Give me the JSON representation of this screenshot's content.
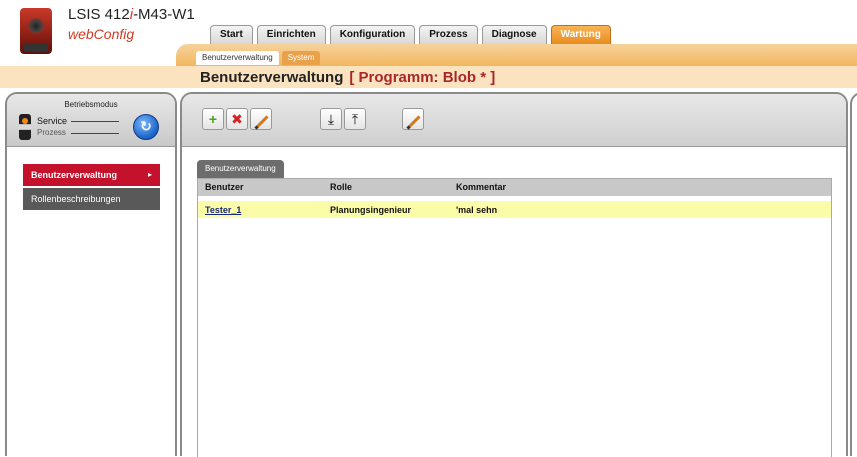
{
  "header": {
    "device_prefix": "LSIS 412",
    "device_italic": "i",
    "device_suffix": "-M43-W1",
    "app_name": "webConfig"
  },
  "main_tabs": [
    "Start",
    "Einrichten",
    "Konfiguration",
    "Prozess",
    "Diagnose",
    "Wartung"
  ],
  "active_main_tab": "Wartung",
  "sub_tabs": [
    "Benutzerverwaltung",
    "System"
  ],
  "page": {
    "title": "Benutzerverwaltung",
    "program": "[ Programm: Blob * ]"
  },
  "mode": {
    "title": "Betriebsmodus",
    "service": "Service",
    "prozess": "Prozess"
  },
  "nav": {
    "items": [
      {
        "label": "Benutzerverwaltung",
        "arrow": "▸"
      },
      {
        "label": "Rollenbeschreibungen"
      }
    ]
  },
  "toolbar": {
    "add": "+",
    "delete": "✖",
    "import": "⤓",
    "export": "⤒"
  },
  "table": {
    "tab_label": "Benutzerverwaltung",
    "columns": [
      "Benutzer",
      "Rolle",
      "Kommentar"
    ],
    "rows": [
      [
        "Tester_1",
        "Planungsingenieur",
        "'mal sehn"
      ]
    ]
  },
  "colors": {
    "accent_orange": "#e98c1d",
    "active_red": "#c4122d",
    "selected_row": "#fbfca8"
  }
}
